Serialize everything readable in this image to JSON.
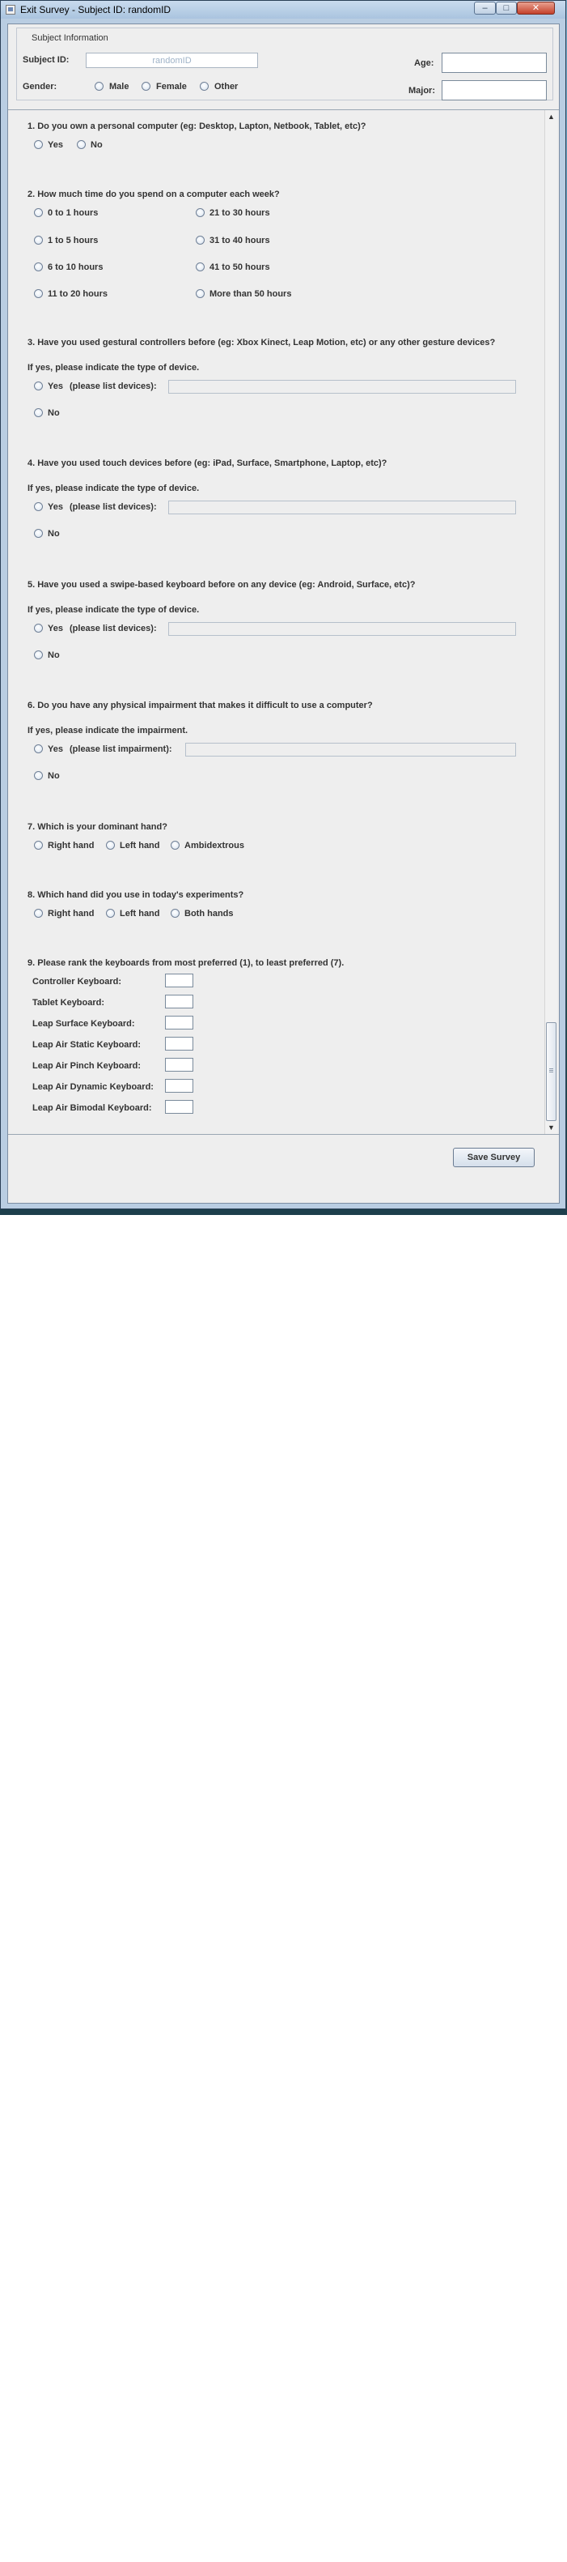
{
  "window": {
    "title": "Exit Survey - Subject ID: randomID",
    "minimize_glyph": "–",
    "maximize_glyph": "□",
    "close_glyph": "✕"
  },
  "subject": {
    "legend": "Subject Information",
    "subject_id_label": "Subject ID:",
    "subject_id_value": "randomID",
    "gender_label": "Gender:",
    "gender_options": [
      "Male",
      "Female",
      "Other"
    ],
    "age_label": "Age:",
    "age_value": "",
    "major_label": "Major:",
    "major_value": ""
  },
  "questions": {
    "q1": {
      "text": "1. Do you own a personal computer (eg: Desktop, Lapton, Netbook, Tablet, etc)?",
      "options": [
        "Yes",
        "No"
      ]
    },
    "q2": {
      "text": "2. How much time do you spend on a computer each week?",
      "options": [
        "0 to 1 hours",
        "21 to 30 hours",
        "1 to 5 hours",
        "31 to 40 hours",
        "6 to 10 hours",
        "41 to 50 hours",
        "11 to 20 hours",
        "More than 50 hours"
      ]
    },
    "q3": {
      "text": "3. Have you used gestural controllers before (eg: Xbox Kinect, Leap Motion, etc) or any other gesture devices?",
      "sub": "If yes, please indicate the type of device.",
      "yes_label": "Yes",
      "detail_label": "(please list devices):",
      "no_label": "No",
      "detail_value": ""
    },
    "q4": {
      "text": "4. Have you used touch devices before (eg: iPad, Surface, Smartphone, Laptop, etc)?",
      "sub": "If yes, please indicate the type of device.",
      "yes_label": "Yes",
      "detail_label": "(please list devices):",
      "no_label": "No",
      "detail_value": ""
    },
    "q5": {
      "text": "5. Have you used a swipe-based keyboard before on any device (eg: Android, Surface, etc)?",
      "sub": "If yes, please indicate the type of device.",
      "yes_label": "Yes",
      "detail_label": "(please list devices):",
      "no_label": "No",
      "detail_value": ""
    },
    "q6": {
      "text": "6. Do you have any physical impairment that makes it difficult to use a computer?",
      "sub": "If yes, please indicate the impairment.",
      "yes_label": "Yes",
      "detail_label": "(please list impairment):",
      "no_label": "No",
      "detail_value": ""
    },
    "q7": {
      "text": "7. Which is your dominant hand?",
      "options": [
        "Right hand",
        "Left hand",
        "Ambidextrous"
      ]
    },
    "q8": {
      "text": "8. Which hand did you use in today's experiments?",
      "options": [
        "Right hand",
        "Left hand",
        "Both hands"
      ]
    },
    "q9": {
      "text": "9. Please rank the keyboards from most preferred (1), to least preferred (7).",
      "keyboards": [
        "Controller Keyboard:",
        "Tablet Keyboard:",
        "Leap Surface Keyboard:",
        "Leap Air Static Keyboard:",
        "Leap Air Pinch Keyboard:",
        "Leap Air Dynamic Keyboard:",
        "Leap Air Bimodal Keyboard:"
      ]
    }
  },
  "scrollbar": {
    "up_glyph": "▲",
    "down_glyph": "▼"
  },
  "footer": {
    "save_label": "Save Survey"
  }
}
